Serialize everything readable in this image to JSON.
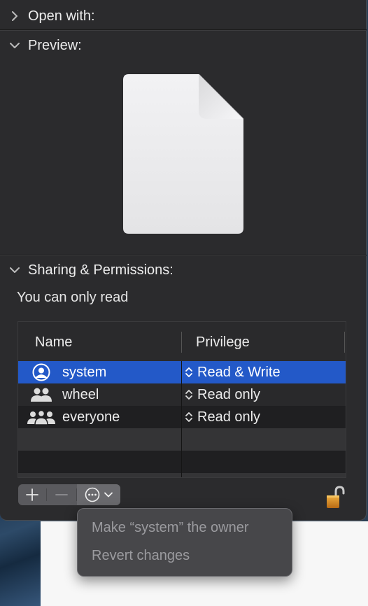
{
  "sections": {
    "open_with": {
      "title": "Open with:"
    },
    "preview": {
      "title": "Preview:"
    },
    "sharing": {
      "title": "Sharing & Permissions:"
    }
  },
  "sharing": {
    "status": "You can only read",
    "columns": {
      "name": "Name",
      "privilege": "Privilege"
    },
    "rows": [
      {
        "name": "system",
        "privilege": "Read & Write",
        "icon": "user-circle-icon",
        "selected": true
      },
      {
        "name": "wheel",
        "privilege": "Read only",
        "icon": "group-icon",
        "selected": false
      },
      {
        "name": "everyone",
        "privilege": "Read only",
        "icon": "everyone-icon",
        "selected": false
      }
    ]
  },
  "controls": {
    "add": "+",
    "remove": "−"
  },
  "action_menu": {
    "items": [
      "Make “system” the owner",
      "Revert changes"
    ]
  },
  "colors": {
    "selection": "#2359c8",
    "window_bg": "#2b2b2d",
    "lock": "#d8902a"
  }
}
